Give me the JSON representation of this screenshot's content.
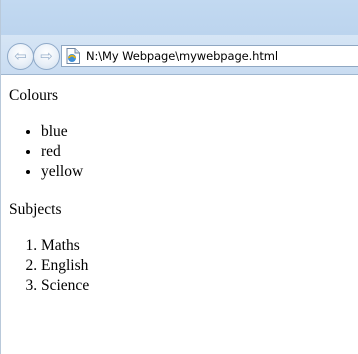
{
  "browser": {
    "back_glyph": "⇦",
    "forward_glyph": "⇨",
    "address": "N:\\My Webpage\\mywebpage.html",
    "page_icon": "html-file-icon"
  },
  "page": {
    "colours_heading": "Colours",
    "colours": [
      "blue",
      "red",
      "yellow"
    ],
    "subjects_heading": "Subjects",
    "subjects": [
      "Maths",
      "English",
      "Science"
    ]
  }
}
